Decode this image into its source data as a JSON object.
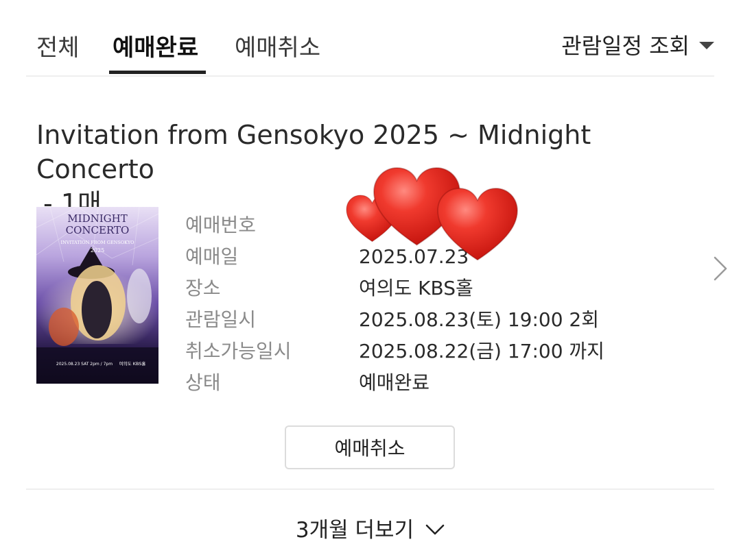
{
  "tabs": [
    {
      "label": "전체",
      "active": false
    },
    {
      "label": "예매완료",
      "active": true
    },
    {
      "label": "예매취소",
      "active": false
    }
  ],
  "schedule_filter": {
    "label": "관람일정 조회"
  },
  "booking": {
    "title": "Invitation from Gensokyo 2025 ~ Midnight Concerto",
    "quantity": "- 1매",
    "poster": {
      "logo_line1": "MIDNIGHT",
      "logo_line2": "CONCERTO",
      "subtitle": "INVITATION FROM GENSOKYO",
      "year": "2025",
      "footer": "2025.08.23 SAT 2pm / 7pm",
      "venue": "여의도 KBS홀"
    },
    "details": [
      {
        "label": "예매번호",
        "value": ""
      },
      {
        "label": "예매일",
        "value": "2025.07.23"
      },
      {
        "label": "장소",
        "value": "여의도 KBS홀"
      },
      {
        "label": "관람일시",
        "value": "2025.08.23(토) 19:00 2회"
      },
      {
        "label": "취소가능일시",
        "value": "2025.08.22(금) 17:00 까지"
      },
      {
        "label": "상태",
        "value": "예매완료"
      }
    ],
    "cancel_button": "예매취소"
  },
  "more": {
    "label": "3개월 더보기"
  },
  "colors": {
    "heart": "#e8221e",
    "label_gray": "#8a8a8a",
    "divider": "#eeeeee"
  }
}
